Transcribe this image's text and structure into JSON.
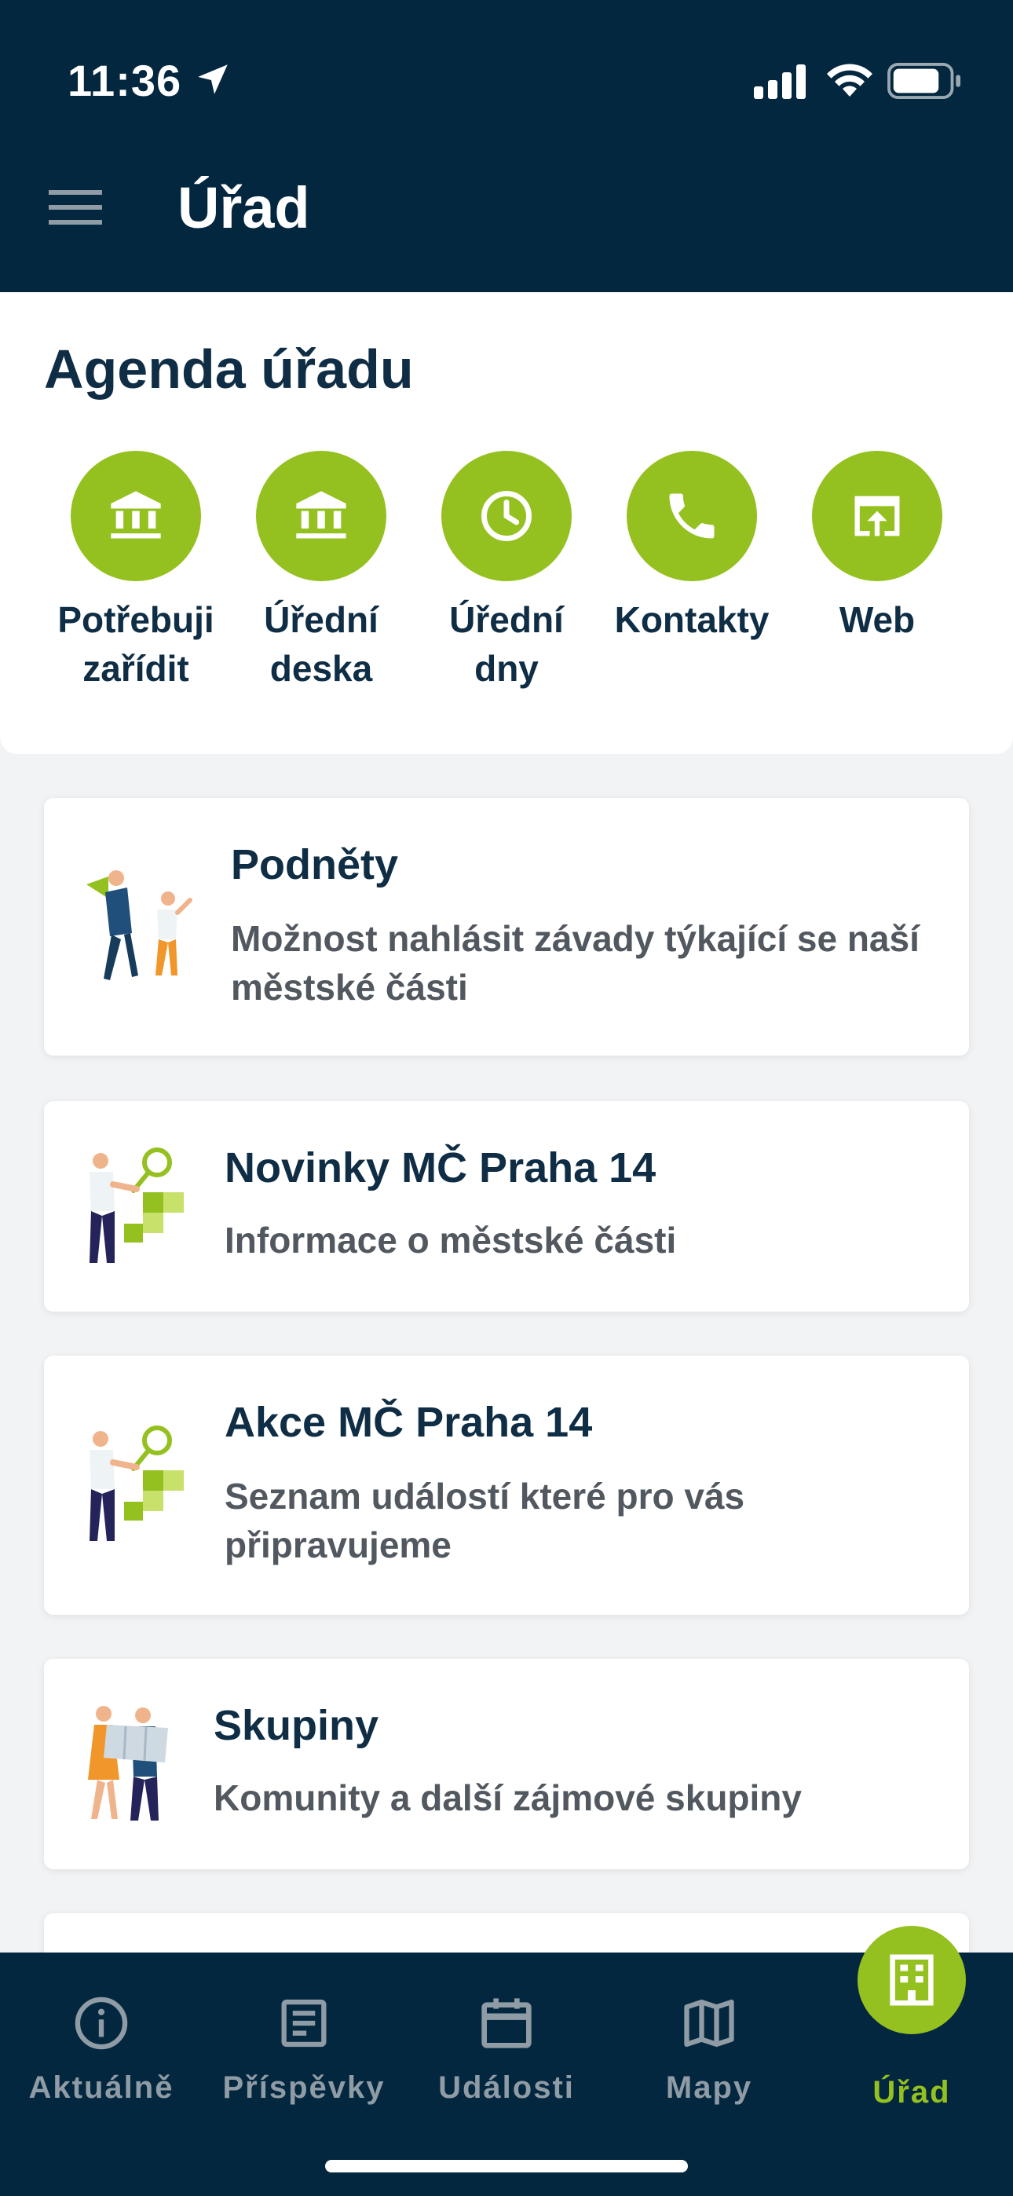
{
  "status_bar": {
    "time": "11:36"
  },
  "header": {
    "title": "Úřad"
  },
  "agenda": {
    "title": "Agenda úřadu",
    "items": [
      {
        "label": "Potřebuji zařídit",
        "icon": "bank-icon"
      },
      {
        "label": "Úřední deska",
        "icon": "bank-icon"
      },
      {
        "label": "Úřední dny",
        "icon": "clock-icon"
      },
      {
        "label": "Kontakty",
        "icon": "phone-icon"
      },
      {
        "label": "Web",
        "icon": "open-in-browser-icon"
      }
    ]
  },
  "cards": [
    {
      "title": "Podněty",
      "description": "Možnost nahlásit závady týkající se naší městské části",
      "icon": "megaphone-people-illustration"
    },
    {
      "title": "Novinky MČ Praha 14",
      "description": "Informace o městské části",
      "icon": "search-people-illustration"
    },
    {
      "title": "Akce MČ Praha 14",
      "description": "Seznam událostí které pro vás připravujeme",
      "icon": "search-people-illustration"
    },
    {
      "title": "Skupiny",
      "description": "Komunity a další zájmové skupiny",
      "icon": "map-people-illustration"
    }
  ],
  "bottom_nav": {
    "items": [
      {
        "label": "Aktuálně",
        "icon": "info-icon"
      },
      {
        "label": "Příspěvky",
        "icon": "article-icon"
      },
      {
        "label": "Události",
        "icon": "calendar-icon"
      },
      {
        "label": "Mapy",
        "icon": "map-icon"
      },
      {
        "label": "Úřad",
        "icon": "building-icon",
        "active": true
      }
    ]
  },
  "colors": {
    "header_bg": "#03273f",
    "accent": "#94c11f",
    "text_dark": "#0f2d44"
  }
}
